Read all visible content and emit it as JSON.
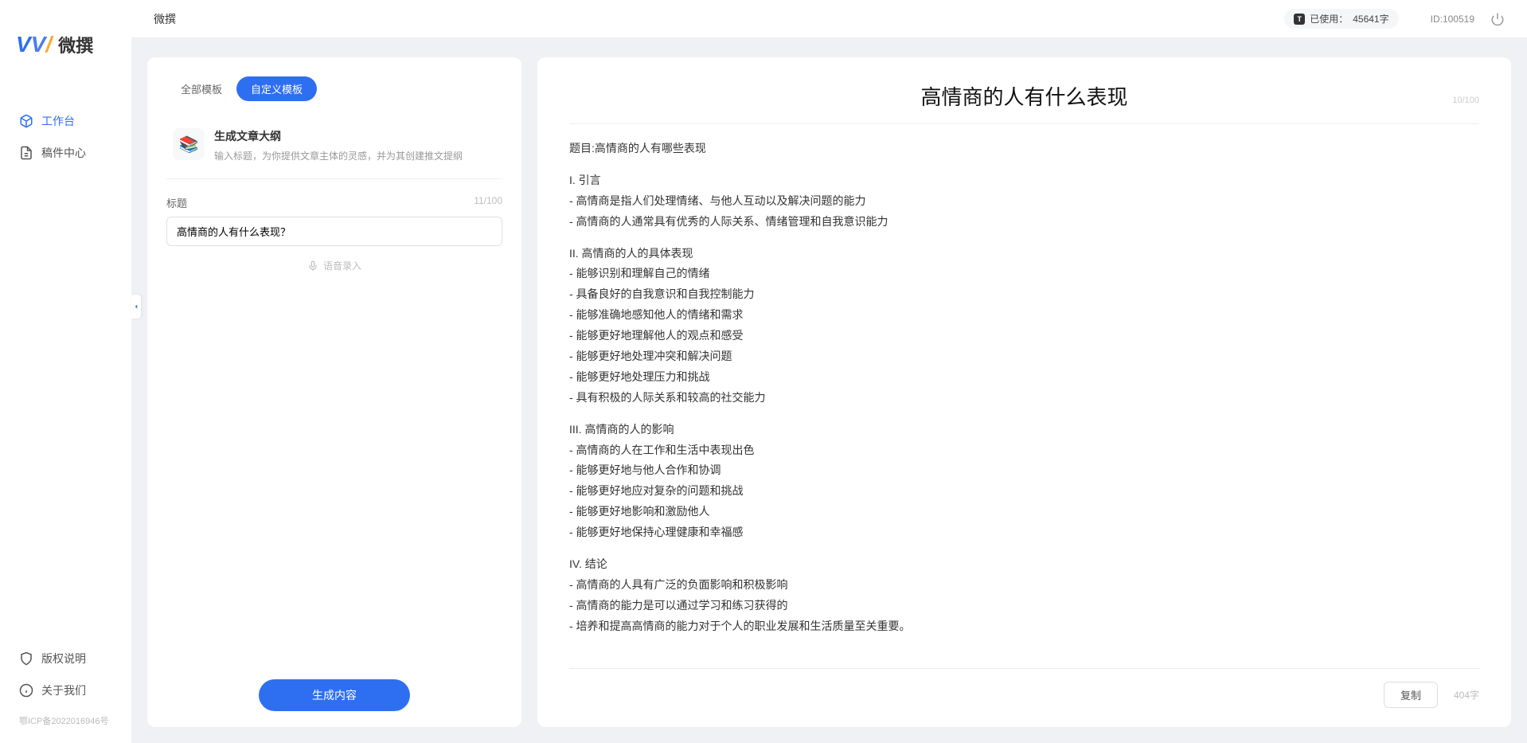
{
  "sidebar": {
    "brand": "微撰",
    "nav": [
      {
        "label": "工作台",
        "icon": "cube"
      },
      {
        "label": "稿件中心",
        "icon": "doc"
      }
    ],
    "footer": [
      {
        "label": "版权说明",
        "icon": "shield"
      },
      {
        "label": "关于我们",
        "icon": "info"
      }
    ],
    "icp": "鄂ICP备2022016946号"
  },
  "topbar": {
    "title": "微撰",
    "usage_label": "已使用：",
    "usage_value": "45641字",
    "id_text": "ID:100519"
  },
  "left_panel": {
    "tabs": [
      "全部模板",
      "自定义模板"
    ],
    "template": {
      "title": "生成文章大纲",
      "desc": "输入标题，为你提供文章主体的灵感，并为其创建推文提纲"
    },
    "field_label": "标题",
    "field_counter": "11/100",
    "title_value": "高情商的人有什么表现？",
    "voice_hint": "语音录入",
    "generate_btn": "生成内容"
  },
  "right_panel": {
    "title": "高情商的人有什么表现",
    "title_counter": "10/100",
    "content_lines": [
      "题目:高情商的人有哪些表现",
      "",
      "I. 引言",
      "- 高情商是指人们处理情绪、与他人互动以及解决问题的能力",
      "- 高情商的人通常具有优秀的人际关系、情绪管理和自我意识能力",
      "",
      "II. 高情商的人的具体表现",
      "- 能够识别和理解自己的情绪",
      "- 具备良好的自我意识和自我控制能力",
      "- 能够准确地感知他人的情绪和需求",
      "- 能够更好地理解他人的观点和感受",
      "- 能够更好地处理冲突和解决问题",
      "- 能够更好地处理压力和挑战",
      "- 具有积极的人际关系和较高的社交能力",
      "",
      "III. 高情商的人的影响",
      "- 高情商的人在工作和生活中表现出色",
      "- 能够更好地与他人合作和协调",
      "- 能够更好地应对复杂的问题和挑战",
      "- 能够更好地影响和激励他人",
      "- 能够更好地保持心理健康和幸福感",
      "",
      "IV. 结论",
      "- 高情商的人具有广泛的负面影响和积极影响",
      "- 高情商的能力是可以通过学习和练习获得的",
      "- 培养和提高高情商的能力对于个人的职业发展和生活质量至关重要。"
    ],
    "copy_btn": "复制",
    "word_count": "404字"
  }
}
